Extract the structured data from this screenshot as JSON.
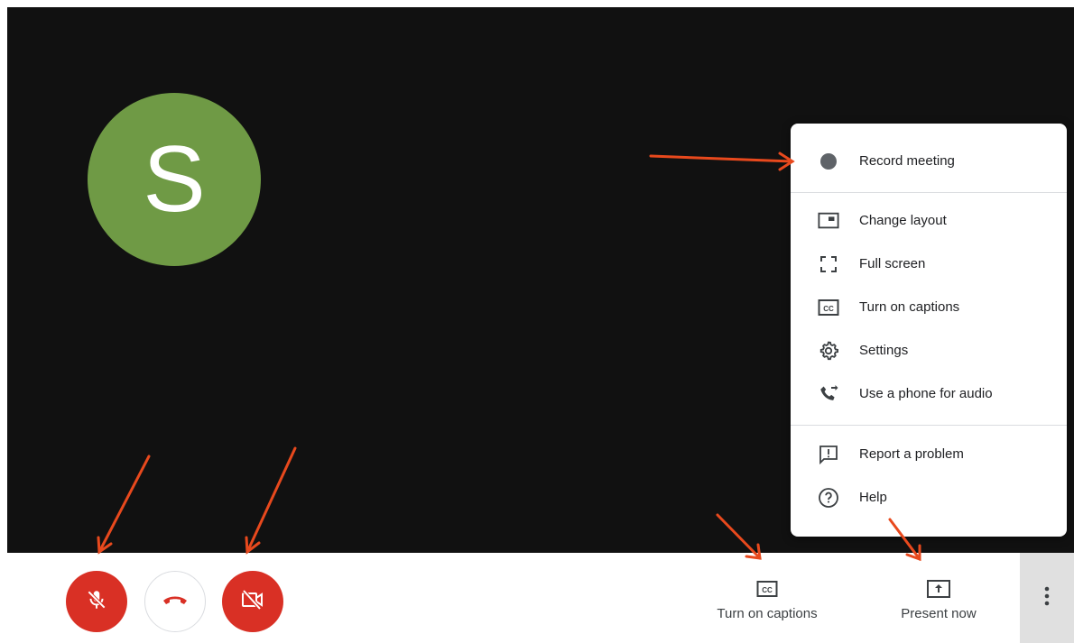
{
  "participant": {
    "initial": "S",
    "avatar_color": "#6f9a45"
  },
  "menu": {
    "items": [
      {
        "label": "Record meeting",
        "icon": "record-dot-icon"
      },
      {
        "label": "Change layout",
        "icon": "layout-icon"
      },
      {
        "label": "Full screen",
        "icon": "fullscreen-icon"
      },
      {
        "label": "Turn on captions",
        "icon": "captions-icon"
      },
      {
        "label": "Settings",
        "icon": "gear-icon"
      },
      {
        "label": "Use a phone for audio",
        "icon": "phone-audio-icon"
      },
      {
        "label": "Report a problem",
        "icon": "report-problem-icon"
      },
      {
        "label": "Help",
        "icon": "help-icon"
      }
    ]
  },
  "controls": {
    "mic": {
      "icon": "mic-off-icon",
      "state": "muted"
    },
    "hangup": {
      "icon": "hang-up-icon"
    },
    "camera": {
      "icon": "camera-off-icon",
      "state": "off"
    },
    "captions_label": "Turn on captions",
    "present_label": "Present now",
    "more": {
      "icon": "more-vertical-icon"
    }
  },
  "colors": {
    "stage_bg": "#111111",
    "danger_red": "#d93025",
    "annotation_arrow": "#e8491d",
    "icon_gray": "#3c4043",
    "record_dot": "#5f6368"
  }
}
